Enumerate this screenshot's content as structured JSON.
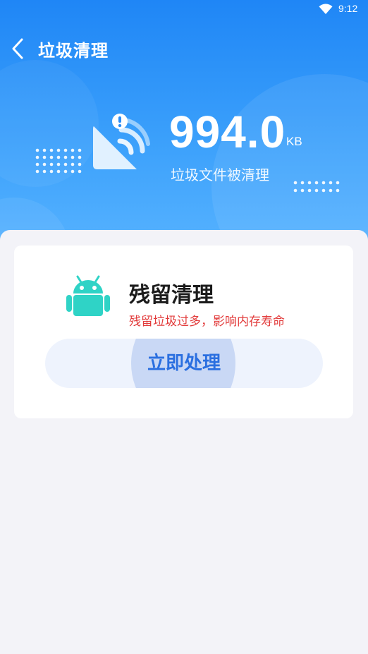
{
  "status_bar": {
    "time": "9:12",
    "icons": [
      "wifi-icon"
    ]
  },
  "header": {
    "title": "垃圾清理",
    "back_icon": "chevron-left-icon",
    "amount_value": "994.0",
    "amount_unit": "KB",
    "caption": "垃圾文件被清理",
    "hero_icon": "cleaned-signal-icon"
  },
  "card": {
    "icon": "android-icon",
    "title": "残留清理",
    "subtitle": "残留垃圾过多，影响内存寿命",
    "button_label": "立即处理"
  },
  "colors": {
    "header_top": "#1f86f6",
    "header_bottom": "#57b3ff",
    "android_green": "#2fd3c6",
    "warning_red": "#e23b3b",
    "button_text": "#2a6fe0",
    "button_bg": "#eef3fd"
  }
}
